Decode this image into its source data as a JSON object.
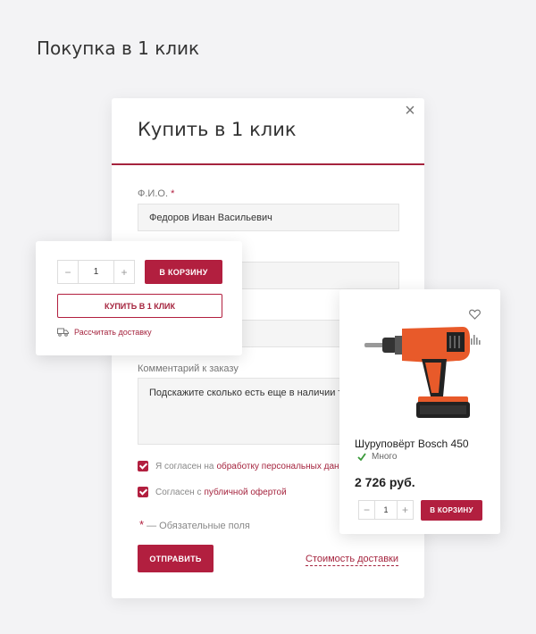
{
  "page": {
    "title": "Покупка в 1 клик"
  },
  "modal": {
    "title": "Купить в 1 клик",
    "close_label": "×",
    "fio_label": "Ф.И.О.",
    "required_mark": "*",
    "fio_value": "Федоров Иван Васильевич",
    "comment_label": "Комментарий к заказу",
    "comment_value": "Подскажите сколько есть еще в наличии това",
    "consent1_prefix": "Я согласен на",
    "consent1_link": "обработку персональных данных",
    "consent2_prefix": "Согласен с",
    "consent2_link": "публичной офертой",
    "required_note": "— Обязательные поля",
    "submit_label": "ОТПРАВИТЬ",
    "delivery_cost_link": "Стоимость доставки"
  },
  "buy_card": {
    "minus": "−",
    "qty": "1",
    "plus": "+",
    "add_to_cart": "В КОРЗИНУ",
    "buy_one_click": "КУПИТЬ В 1 КЛИК",
    "calc_delivery": "Рассчитать доставку",
    "truck_icon": "truck-icon"
  },
  "product_card": {
    "name": "Шуруповёрт Bosch 450",
    "stock": "Много",
    "price": "2 726 руб.",
    "minus": "−",
    "qty": "1",
    "plus": "+",
    "add_to_cart": "В КОРЗИНУ",
    "icons": [
      "heart-icon",
      "compare-icon",
      "check-icon"
    ]
  },
  "colors": {
    "accent": "#b21f3f",
    "accent_dark": "#a5243e",
    "background": "#f3f3f5",
    "field_bg": "#f5f5f5",
    "check_green": "#3a9a3a"
  }
}
